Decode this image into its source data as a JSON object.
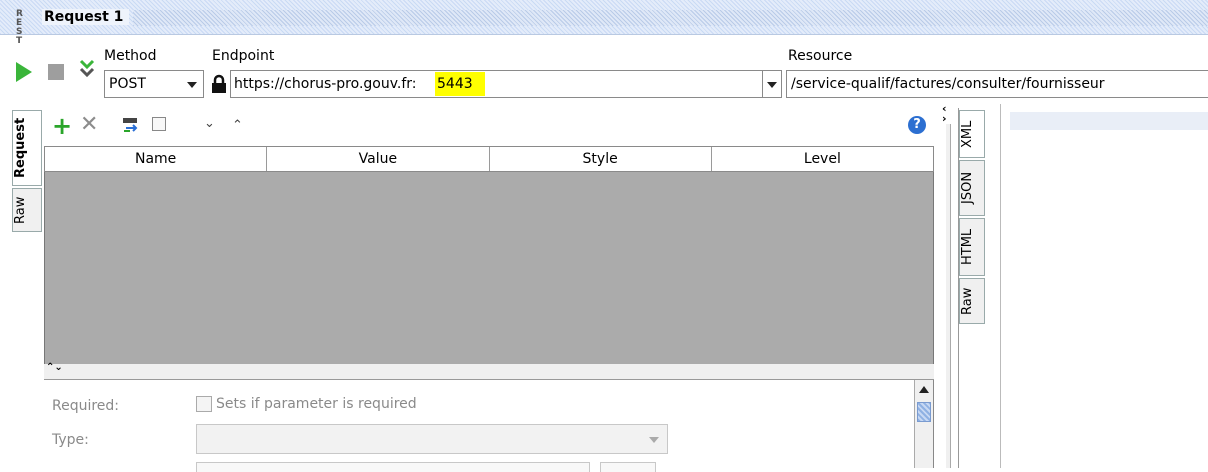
{
  "title": {
    "icon_text": "RE ST",
    "text": "Request 1"
  },
  "toolbar": {
    "method_label": "Method",
    "method_value": "POST",
    "endpoint_label": "Endpoint",
    "endpoint_value": "https://chorus-pro.gouv.fr:",
    "endpoint_port": "5443",
    "resource_label": "Resource",
    "resource_value": "/service-qualif/factures/consulter/fournisseur"
  },
  "request_tabs": [
    "Request",
    "Raw"
  ],
  "grid": {
    "columns": [
      "Name",
      "Value",
      "Style",
      "Level"
    ]
  },
  "details": {
    "required_label": "Required:",
    "required_checkbox_text": "Sets if parameter is required",
    "type_label": "Type:"
  },
  "response_tabs": [
    "XML",
    "JSON",
    "HTML",
    "Raw"
  ],
  "colors": {
    "run_green": "#3ab53a",
    "highlight": "#ffff00",
    "add_green": "#2aa52a",
    "grid_bg": "#ababab"
  }
}
